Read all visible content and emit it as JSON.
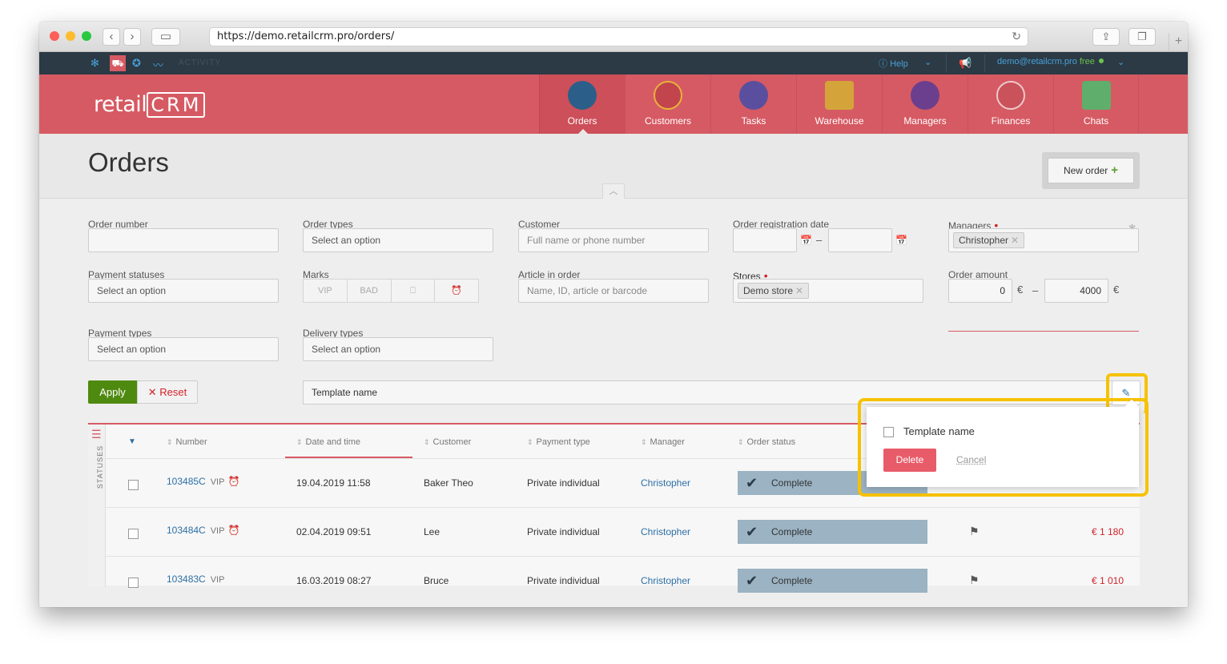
{
  "browser": {
    "url": "https://demo.retailcrm.pro/orders/"
  },
  "topbar": {
    "activity_label": "ACTIVITY",
    "help_label": "Help",
    "user_email": "demo@retailcrm.pro",
    "plan_label": "free"
  },
  "logo": {
    "prefix": "retail",
    "suffix": "CRM"
  },
  "nav": {
    "items": [
      {
        "label": "Orders",
        "color": "#2b5f8a"
      },
      {
        "label": "Customers",
        "color": "#c2454e"
      },
      {
        "label": "Tasks",
        "color": "#5a4f9e"
      },
      {
        "label": "Warehouse",
        "color": "#d4a43a"
      },
      {
        "label": "Managers",
        "color": "#6b3f8e"
      },
      {
        "label": "Finances",
        "color": "#c9525b"
      },
      {
        "label": "Chats",
        "color": "#5fae6b"
      }
    ]
  },
  "header": {
    "title": "Orders",
    "new_order_label": "New order"
  },
  "filters": {
    "order_number": {
      "label": "Order number",
      "value": ""
    },
    "order_types": {
      "label": "Order types",
      "placeholder": "Select an option"
    },
    "customer": {
      "label": "Customer",
      "placeholder": "Full name or phone number"
    },
    "reg_date": {
      "label": "Order registration date",
      "dash": "–"
    },
    "managers": {
      "label": "Managers",
      "required": "•",
      "tag": "Christopher"
    },
    "payment_statuses": {
      "label": "Payment statuses",
      "placeholder": "Select an option"
    },
    "marks": {
      "label": "Marks",
      "items": [
        "VIP",
        "BAD",
        "⎕",
        "⏰"
      ]
    },
    "article": {
      "label": "Article in order",
      "placeholder": "Name, ID, article or barcode"
    },
    "stores": {
      "label": "Stores",
      "required": "•",
      "tag": "Demo store"
    },
    "order_amount": {
      "label": "Order amount",
      "from": "0",
      "to": "4000",
      "currency": "€",
      "dash": "–"
    },
    "payment_types": {
      "label": "Payment types",
      "placeholder": "Select an option"
    },
    "delivery_types": {
      "label": "Delivery types",
      "placeholder": "Select an option"
    },
    "apply_label": "Apply",
    "reset_label": "Reset",
    "template_value": "Template name"
  },
  "table": {
    "side_label": "STATUSES",
    "columns": [
      "Number",
      "Date and time",
      "Customer",
      "Payment type",
      "Manager",
      "Order status"
    ],
    "rows": [
      {
        "number": "103485C",
        "vip": "VIP",
        "alarm": "⏰",
        "date": "19.04.2019 11:58",
        "customer": "Baker Theo",
        "payment": "Private individual",
        "manager": "Christopher",
        "status": "Complete",
        "price": ""
      },
      {
        "number": "103484C",
        "vip": "VIP",
        "alarm": "⏰",
        "date": "02.04.2019 09:51",
        "customer": "Lee",
        "payment": "Private individual",
        "manager": "Christopher",
        "status": "Complete",
        "price": "€ 1 180"
      },
      {
        "number": "103483C",
        "vip": "VIP",
        "alarm": "",
        "date": "16.03.2019 08:27",
        "customer": "Bruce",
        "payment": "Private individual",
        "manager": "Christopher",
        "status": "Complete",
        "price": "€ 1 010"
      }
    ]
  },
  "popup": {
    "template_label": "Template name",
    "delete_label": "Delete",
    "cancel_label": "Cancel"
  }
}
